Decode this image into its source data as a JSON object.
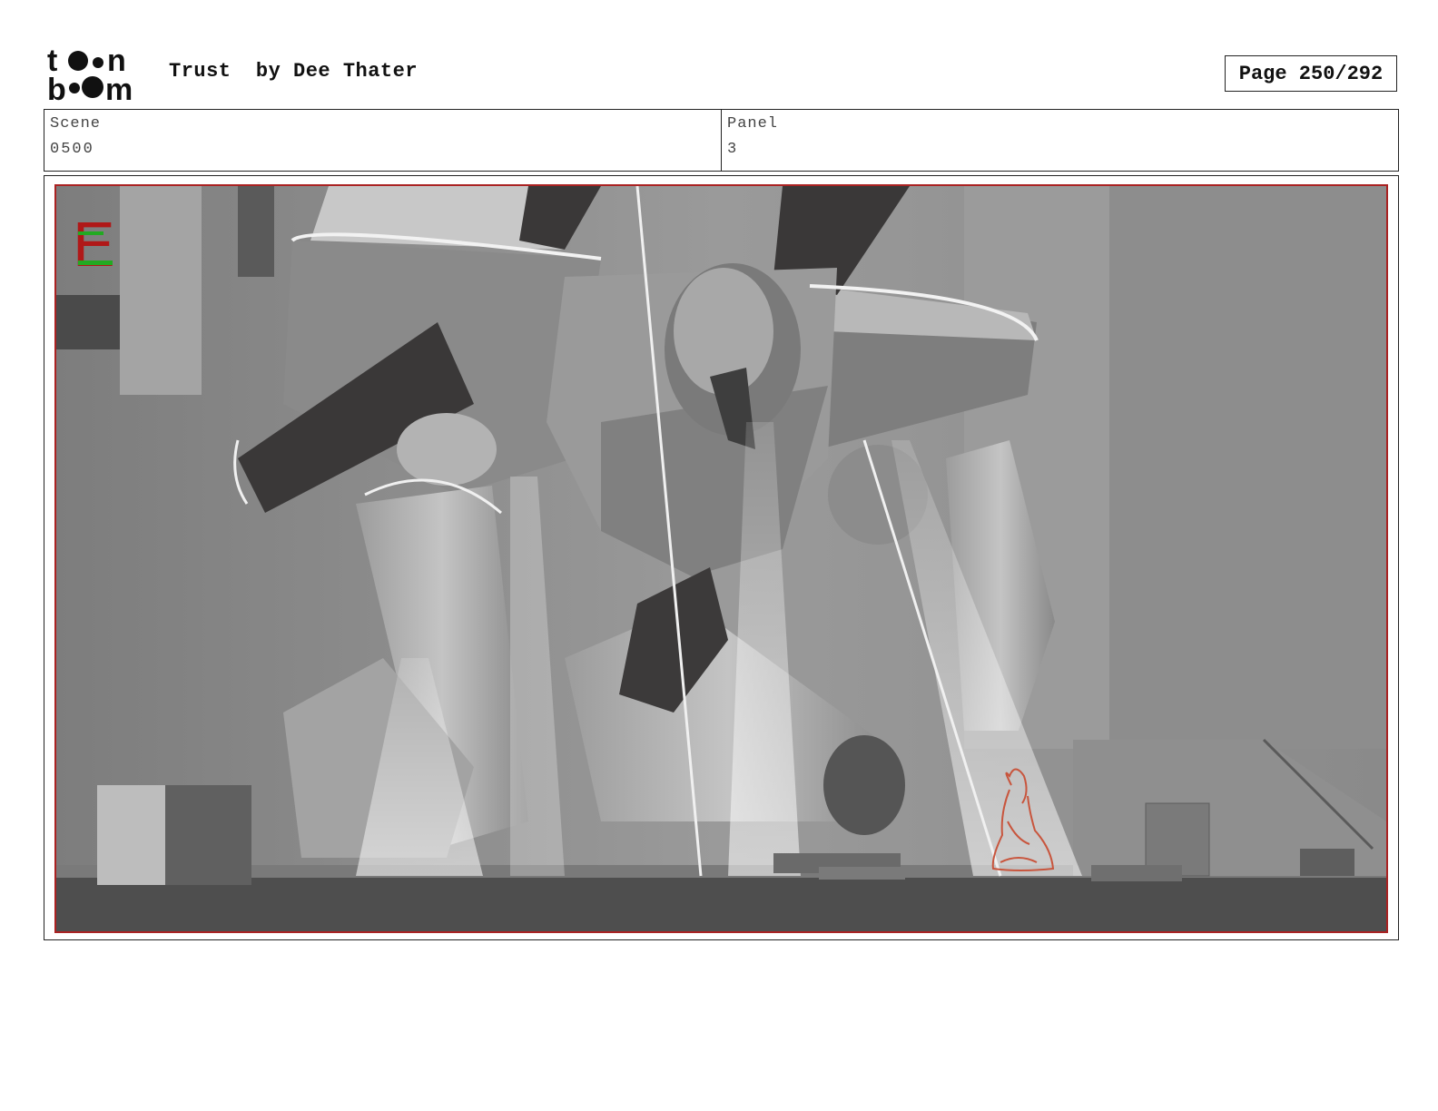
{
  "header": {
    "logo_text": "toon boom",
    "title": "Trust  by Dee Thater",
    "page_label": "Page 250/292"
  },
  "info": {
    "scene_label": "Scene",
    "scene_value": "0500",
    "panel_label": "Panel",
    "panel_value": "3"
  },
  "panel": {
    "corner_mark": "E",
    "colors": {
      "frame_border": "#aa2222",
      "corner_mark_red": "#b01818",
      "corner_mark_green": "#22aa22",
      "sketch_stroke": "#c8553d",
      "background_gray": "#8e8e8e"
    }
  }
}
